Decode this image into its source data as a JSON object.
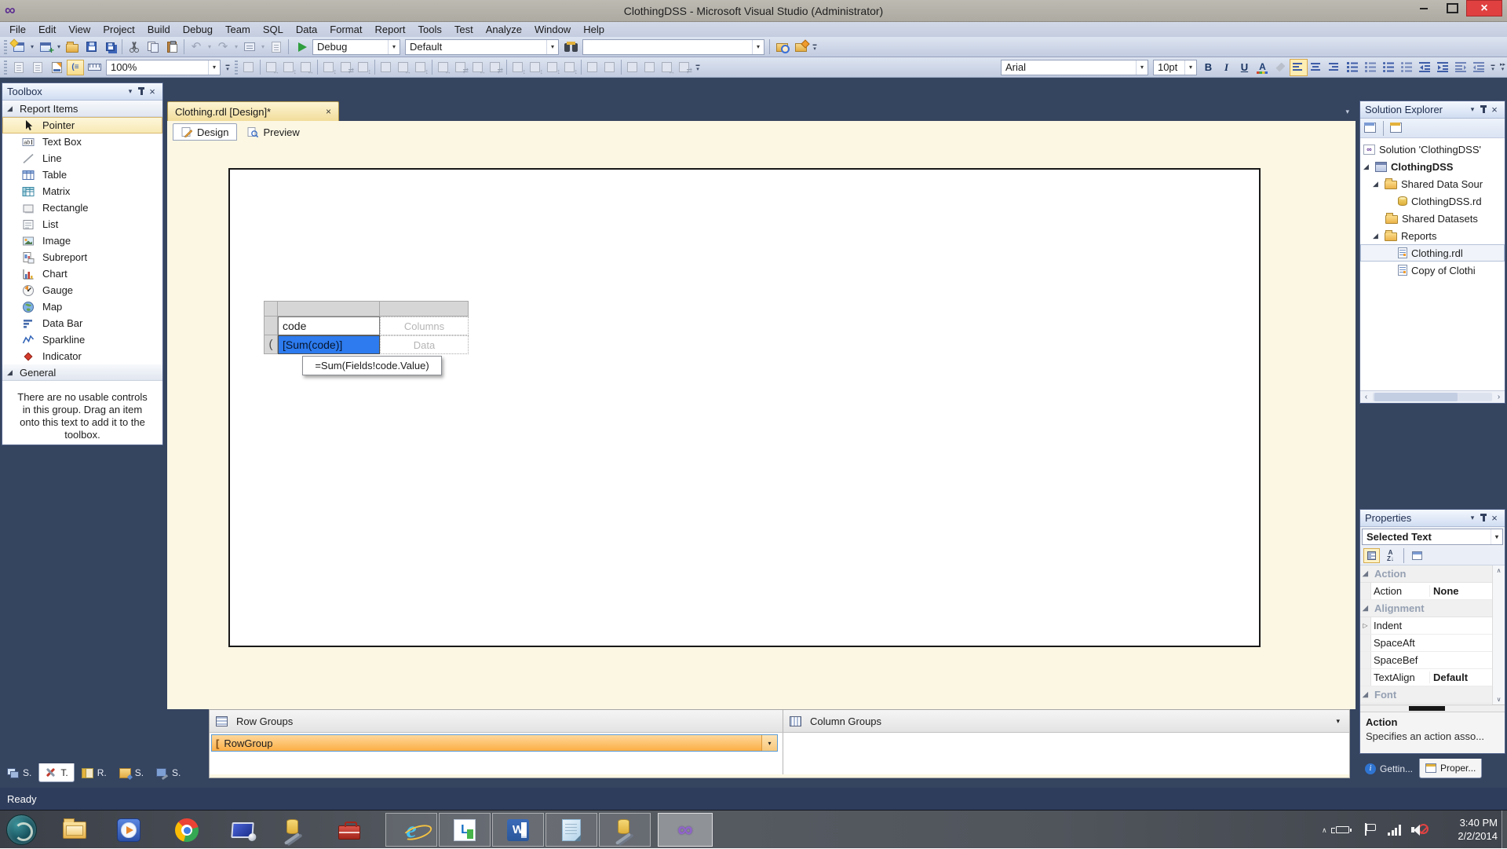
{
  "window": {
    "title": "ClothingDSS - Microsoft Visual Studio (Administrator)"
  },
  "menu": [
    "File",
    "Edit",
    "View",
    "Project",
    "Build",
    "Debug",
    "Team",
    "SQL",
    "Data",
    "Format",
    "Report",
    "Tools",
    "Test",
    "Analyze",
    "Window",
    "Help"
  ],
  "toolbar": {
    "debug_target": "Debug",
    "solution_config": "Default",
    "find_box": "",
    "zoom_level": "100%",
    "font_name": "Arial",
    "font_size": "10pt",
    "bold_label": "B",
    "italic_label": "I",
    "underline_label": "U"
  },
  "toolbox": {
    "title": "Toolbox",
    "report_items_group": "Report Items",
    "items": [
      "Pointer",
      "Text Box",
      "Line",
      "Table",
      "Matrix",
      "Rectangle",
      "List",
      "Image",
      "Subreport",
      "Chart",
      "Gauge",
      "Map",
      "Data Bar",
      "Sparkline",
      "Indicator"
    ],
    "general_group": "General",
    "general_message": "There are no usable controls in this group. Drag an item onto this text to add it to the toolbox."
  },
  "document": {
    "tab_title": "Clothing.rdl [Design]*",
    "design_tab": "Design",
    "preview_tab": "Preview"
  },
  "matrix": {
    "cell_code": "code",
    "cell_columns": "Columns",
    "cell_sum": "[Sum(code)]",
    "cell_data": "Data",
    "tooltip": "=Sum(Fields!code.Value)",
    "row_group_bracket": "("
  },
  "grouping": {
    "row_groups_title": "Row Groups",
    "column_groups_title": "Column Groups",
    "row_group_item": "RowGroup"
  },
  "solution_explorer": {
    "title": "Solution Explorer",
    "solution": "Solution 'ClothingDSS'",
    "project": "ClothingDSS",
    "shared_data_sources": "Shared Data Sour",
    "data_source_file": "ClothingDSS.rd",
    "shared_datasets": "Shared Datasets",
    "reports_folder": "Reports",
    "report_file": "Clothing.rdl",
    "report_copy": "Copy of Clothi"
  },
  "properties": {
    "title": "Properties",
    "selected_object": "Selected Text",
    "cat_action": "Action",
    "row_action_name": "Action",
    "row_action_value": "None",
    "cat_alignment": "Alignment",
    "row_indent": "Indent",
    "row_spaceafter": "SpaceAft",
    "row_spacebefore": "SpaceBef",
    "row_textalign": "TextAlign",
    "row_textalign_value": "Default",
    "cat_font": "Font",
    "description_title": "Action",
    "description_text": "Specifies an action asso...",
    "tab_getting_started": "Gettin...",
    "tab_properties": "Proper..."
  },
  "bottom_tabs": [
    "S.",
    "T.",
    "R.",
    "S.",
    "S."
  ],
  "status_bar": {
    "text": "Ready"
  },
  "taskbar": {
    "time": "3:40 PM",
    "date": "2/2/2014"
  },
  "colors": {
    "selection_blue": "#2d7bee",
    "rowgroup_orange": "#fbae45",
    "design_background": "#fcf7e3",
    "titlebar_close": "#e04040"
  }
}
